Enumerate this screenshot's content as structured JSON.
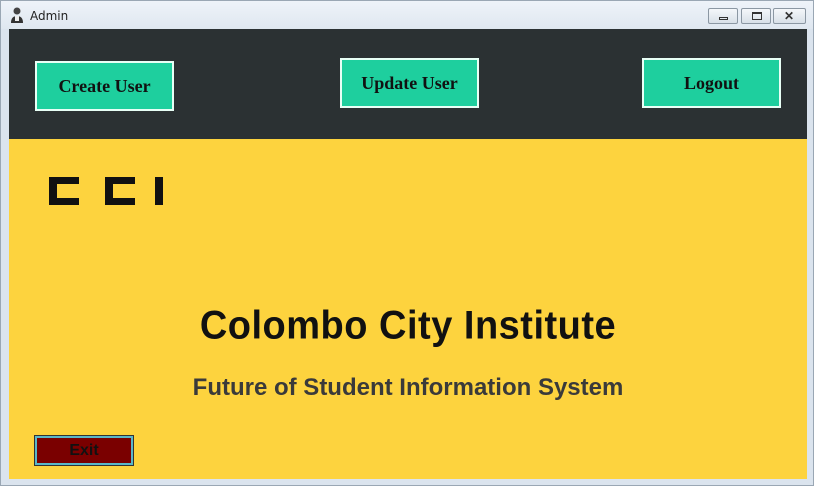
{
  "window": {
    "title": "Admin"
  },
  "header": {
    "create_user_label": "Create User",
    "update_user_label": "Update User",
    "logout_label": "Logout"
  },
  "main": {
    "logo_text": "CCI",
    "institute_name": "Colombo City Institute",
    "subtitle": "Future of Student Information System",
    "exit_label": "Exit"
  },
  "colors": {
    "header_bg": "#2b3133",
    "button_bg": "#1ecf9e",
    "content_bg": "#fdd33e",
    "exit_bg": "#7a0000"
  },
  "icons": {
    "app": "user-icon",
    "minimize": "minimize-icon",
    "maximize": "maximize-icon",
    "close": "close-icon"
  }
}
